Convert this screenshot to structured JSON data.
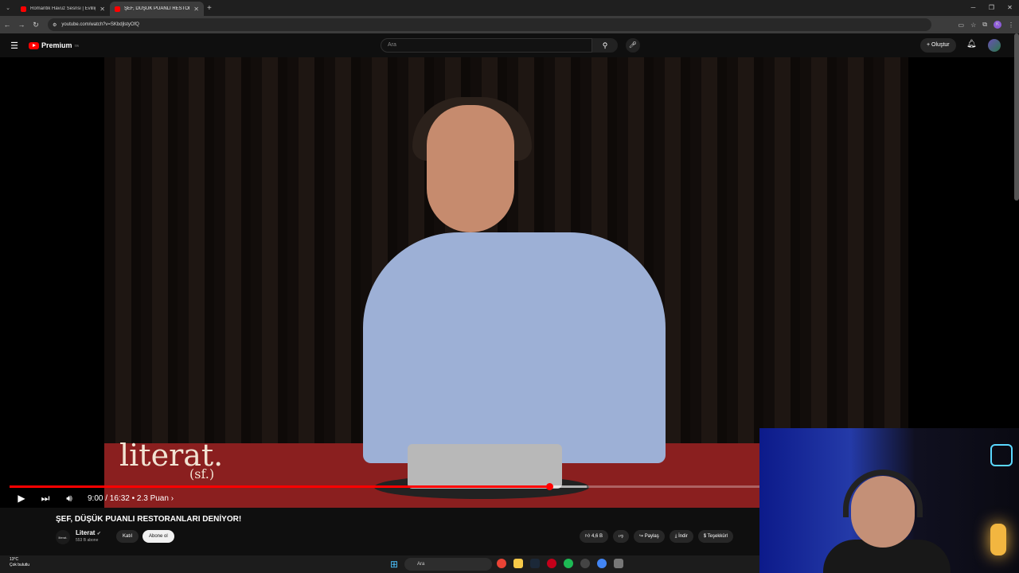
{
  "browser": {
    "tabs": [
      {
        "title": "Romantik Havuz Sesnsi | Evliliğ..."
      },
      {
        "title": "ŞEF, DÜŞÜK PUANLI RESTORAN..."
      }
    ],
    "new_tab": "+",
    "url": "youtube.com/watch?v=SKbdjlstyOfQ"
  },
  "youtube": {
    "logo_text": "Premium",
    "logo_region": "TR",
    "search_placeholder": "Ara",
    "create_label": "Oluştur"
  },
  "video": {
    "watermark": "literat.",
    "watermark_sub": "(sf.)",
    "time": "9:00 / 16:32",
    "chapter": "• 2.3 Puan ›",
    "progress": 0.72,
    "buffered": 0.77
  },
  "info": {
    "title": "ŞEF, DÜŞÜK PUANLI RESTORANLARI DENİYOR!",
    "channel_avatar": "literat.",
    "channel_name": "Literat",
    "subscribers": "553 B abone",
    "join_label": "Katıl",
    "subscribe_label": "Abone ol",
    "likes": "4,6 B",
    "share_label": "Paylaş",
    "download_label": "İndir",
    "thanks_label": "Teşekkürl"
  },
  "taskbar": {
    "temperature": "13°C",
    "weather": "Çok bulutlu",
    "search_placeholder": "Ara"
  },
  "icons": {
    "play": "play-icon",
    "next": "next-icon",
    "volume": "volume-icon",
    "search": "search-icon",
    "mic": "mic-icon",
    "bell": "bell-icon"
  },
  "colors": {
    "accent": "#ff0000",
    "background": "#0f0f0f"
  }
}
